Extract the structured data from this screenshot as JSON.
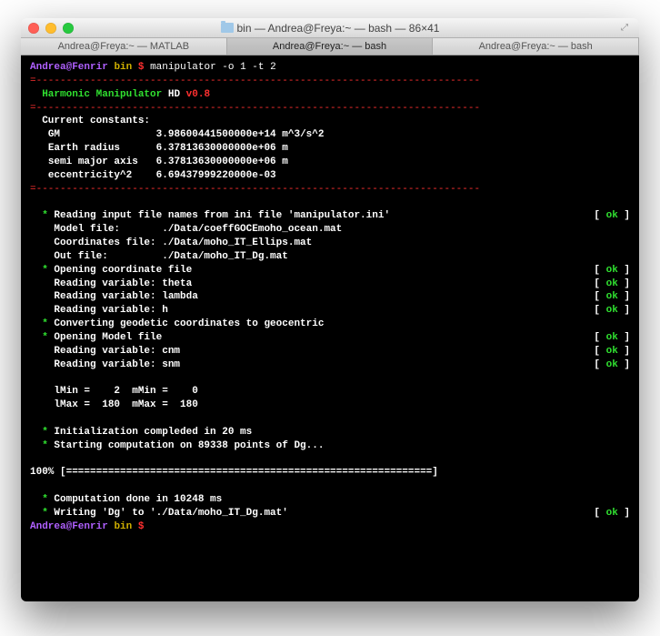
{
  "window": {
    "title": "bin — Andrea@Freya:~ — bash — 86×41"
  },
  "tabs": [
    "Andrea@Freya:~ — MATLAB",
    "Andrea@Freya:~ — bash",
    "Andrea@Freya:~ — bash"
  ],
  "prompt": {
    "user": "Andrea@Fenrir",
    "cwd": "bin",
    "symbol": "$",
    "command": "manipulator -o 1 -t 2"
  },
  "header": {
    "hr": "=--------------------------------------------------------------------------",
    "title_a": "Harmonic Manipulator",
    "title_b": "HD",
    "title_c": "v0.8"
  },
  "constants_header": "Current constants:",
  "constants": [
    {
      "label": "GM",
      "value": "3.98600441500000e+14 m^3/s^2"
    },
    {
      "label": "Earth radius",
      "value": "6.37813630000000e+06 m"
    },
    {
      "label": "semi major axis",
      "value": "6.37813630000000e+06 m"
    },
    {
      "label": "eccentricity^2",
      "value": "6.69437999220000e-03"
    }
  ],
  "steps": [
    {
      "star": true,
      "text": "Reading input file names from ini file 'manipulator.ini'",
      "ok": true,
      "indent": 1
    },
    {
      "star": false,
      "text": "Model file:       ./Data/coeffGOCEmoho_ocean.mat",
      "ok": false,
      "indent": 2
    },
    {
      "star": false,
      "text": "Coordinates file: ./Data/moho_IT_Ellips.mat",
      "ok": false,
      "indent": 2
    },
    {
      "star": false,
      "text": "Out file:         ./Data/moho_IT_Dg.mat",
      "ok": false,
      "indent": 2
    },
    {
      "star": true,
      "text": "Opening coordinate file",
      "ok": true,
      "indent": 1
    },
    {
      "star": false,
      "text": "Reading variable: theta",
      "ok": true,
      "indent": 2
    },
    {
      "star": false,
      "text": "Reading variable: lambda",
      "ok": true,
      "indent": 2
    },
    {
      "star": false,
      "text": "Reading variable: h",
      "ok": true,
      "indent": 2
    },
    {
      "star": true,
      "text": "Converting geodetic coordinates to geocentric",
      "ok": false,
      "indent": 1
    },
    {
      "star": true,
      "text": "Opening Model file",
      "ok": true,
      "indent": 1
    },
    {
      "star": false,
      "text": "Reading variable: cnm",
      "ok": true,
      "indent": 2
    },
    {
      "star": false,
      "text": "Reading variable: snm",
      "ok": true,
      "indent": 2
    }
  ],
  "ranges": [
    "lMin =    2  mMin =    0",
    "lMax =  180  mMax =  180"
  ],
  "init": "Initialization compleded in 20 ms",
  "start": "Starting computation on 89338 points of Dg...",
  "progress": {
    "pct": "100%",
    "bar": "[=============================================================]"
  },
  "done": "Computation done in 10248 ms",
  "writing": "Writing 'Dg' to './Data/moho_IT_Dg.mat'",
  "ok_left": "[ ",
  "ok_mid": "ok",
  "ok_right": " ]"
}
